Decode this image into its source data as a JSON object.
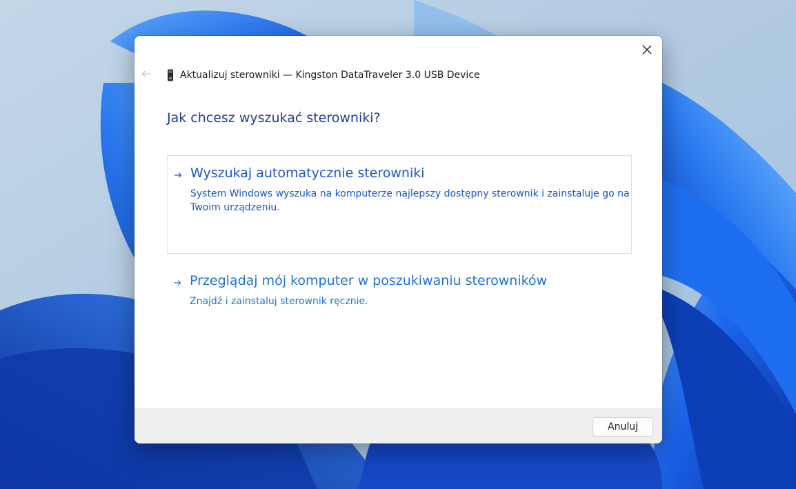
{
  "dialog": {
    "title": "Aktualizuj sterowniki — Kingston DataTraveler 3.0 USB Device",
    "heading": "Jak chcesz wyszukać sterowniki?",
    "options": [
      {
        "title": "Wyszukaj automatycznie sterowniki",
        "description": "System Windows wyszuka na komputerze najlepszy dostępny sterownik i zainstaluje go na Twoim urządzeniu."
      },
      {
        "title": "Przeglądaj mój komputer w poszukiwaniu sterowników",
        "description": "Znajdź i zainstaluj sterownik ręcznie."
      }
    ],
    "cancel_label": "Anuluj"
  },
  "icons": {
    "close": "close-icon",
    "back": "back-arrow-icon",
    "device": "usb-drive-icon",
    "option_arrow": "arrow-right-icon"
  },
  "colors": {
    "heading": "#1e3f8f",
    "link_primary": "#1c55c8",
    "link_secondary": "#2174cf",
    "footer_bg": "#efefef",
    "wallpaper_blue": "#1f5fe0"
  }
}
